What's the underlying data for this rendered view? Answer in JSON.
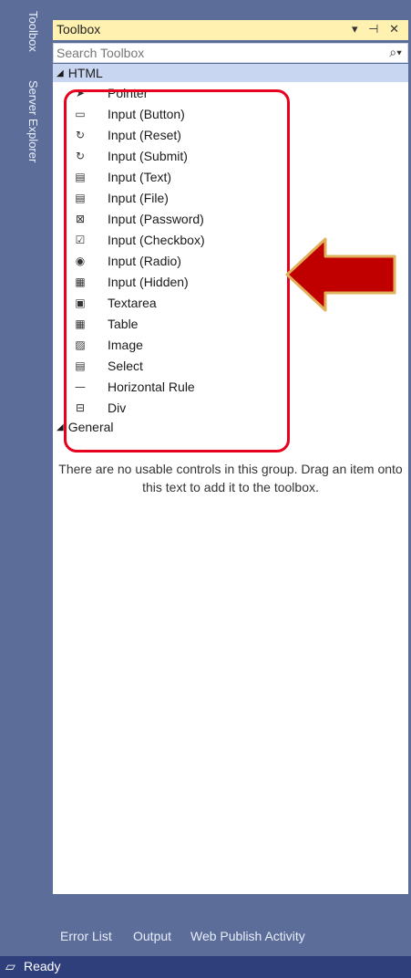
{
  "side_tabs": [
    "Toolbox",
    "Server Explorer"
  ],
  "toolbox": {
    "title": "Toolbox",
    "search_placeholder": "Search Toolbox",
    "controls": "▾ ⊣ ✕"
  },
  "groups": [
    {
      "name": "HTML",
      "items": [
        {
          "label": "Pointer",
          "icon": "pointer-icon"
        },
        {
          "label": "Input (Button)",
          "icon": "button-icon"
        },
        {
          "label": "Input (Reset)",
          "icon": "reset-icon"
        },
        {
          "label": "Input (Submit)",
          "icon": "submit-icon"
        },
        {
          "label": "Input (Text)",
          "icon": "text-input-icon"
        },
        {
          "label": "Input (File)",
          "icon": "file-input-icon"
        },
        {
          "label": "Input (Password)",
          "icon": "password-icon"
        },
        {
          "label": "Input (Checkbox)",
          "icon": "checkbox-icon"
        },
        {
          "label": "Input (Radio)",
          "icon": "radio-icon"
        },
        {
          "label": "Input (Hidden)",
          "icon": "hidden-input-icon"
        },
        {
          "label": "Textarea",
          "icon": "textarea-icon"
        },
        {
          "label": "Table",
          "icon": "table-icon"
        },
        {
          "label": "Image",
          "icon": "image-icon"
        },
        {
          "label": "Select",
          "icon": "select-icon"
        },
        {
          "label": "Horizontal Rule",
          "icon": "horizontal-rule-icon"
        },
        {
          "label": "Div",
          "icon": "div-icon"
        }
      ]
    },
    {
      "name": "General",
      "empty_message": "There are no usable controls in this group. Drag an item onto this text to add it to the toolbox."
    }
  ],
  "bottom_tabs": [
    "Error List",
    "Output",
    "Web Publish Activity"
  ],
  "status": {
    "text": "Ready"
  },
  "colors": {
    "highlight": "#e8001f",
    "arrow": "#c00000",
    "status_bar": "#2f3f7c",
    "title_bar": "#fff1b0"
  }
}
